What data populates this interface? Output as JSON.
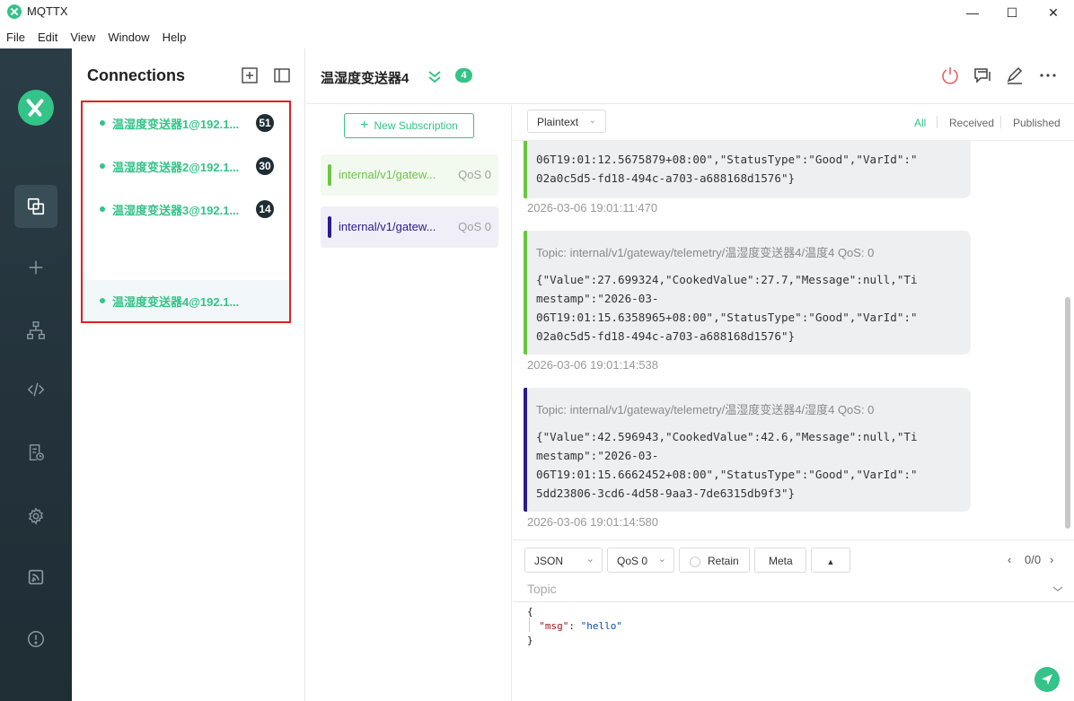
{
  "window": {
    "title": "MQTTX",
    "minimize": "—",
    "maximize": "☐",
    "close": "✕"
  },
  "menu": [
    "File",
    "Edit",
    "View",
    "Window",
    "Help"
  ],
  "colors": {
    "accent": "#34c388",
    "sidebar": "#24333c",
    "highlight_border": "#e02020"
  },
  "connections": {
    "title": "Connections",
    "items": [
      {
        "name": "温湿度变送器1@192.1...",
        "badge": "51"
      },
      {
        "name": "温湿度变送器2@192.1...",
        "badge": "30"
      },
      {
        "name": "温湿度变送器3@192.1...",
        "badge": "14"
      },
      {
        "name": "温湿度变送器4@192.1...",
        "badge": ""
      }
    ]
  },
  "header": {
    "title": "温湿度变送器4",
    "count": "4"
  },
  "subscriptions": {
    "new_label": "New Subscription",
    "items": [
      {
        "topic": "internal/v1/gatew...",
        "qos": "QoS 0",
        "color": "#6cc644"
      },
      {
        "topic": "internal/v1/gatew...",
        "qos": "QoS 0",
        "color": "#2c1a8f"
      }
    ]
  },
  "messages": {
    "format": "Plaintext",
    "filters": [
      "All",
      "Received",
      "Published"
    ],
    "items": [
      {
        "topic": "",
        "payload": "06T19:01:12.5675879+08:00\",\"StatusType\":\"Good\",\"VarId\":\"\n02a0c5d5-fd18-494c-a703-a688168d1576\"}",
        "time": "2026-03-06 19:01:11:470"
      },
      {
        "topic": "Topic: internal/v1/gateway/telemetry/温湿度变送器4/温度4    QoS: 0",
        "payload": "{\"Value\":27.699324,\"CookedValue\":27.7,\"Message\":null,\"Ti\nmestamp\":\"2026-03-\n06T19:01:15.6358965+08:00\",\"StatusType\":\"Good\",\"VarId\":\"\n02a0c5d5-fd18-494c-a703-a688168d1576\"}",
        "time": "2026-03-06 19:01:14:538"
      },
      {
        "topic": "Topic: internal/v1/gateway/telemetry/温湿度变送器4/湿度4    QoS: 0",
        "payload": "{\"Value\":42.596943,\"CookedValue\":42.6,\"Message\":null,\"Ti\nmestamp\":\"2026-03-\n06T19:01:15.6662452+08:00\",\"StatusType\":\"Good\",\"VarId\":\"\n5dd23806-3cd6-4d58-9aa3-7de6315db9f3\"}",
        "time": "2026-03-06 19:01:14:580"
      }
    ]
  },
  "publish": {
    "payload_type": "JSON",
    "qos": "QoS 0",
    "retain": "Retain",
    "meta": "Meta",
    "history": "0/0",
    "topic_placeholder": "Topic",
    "payload_open": "{",
    "payload_key": "\"msg\"",
    "payload_colon": ": ",
    "payload_value": "\"hello\"",
    "payload_close": "}"
  }
}
